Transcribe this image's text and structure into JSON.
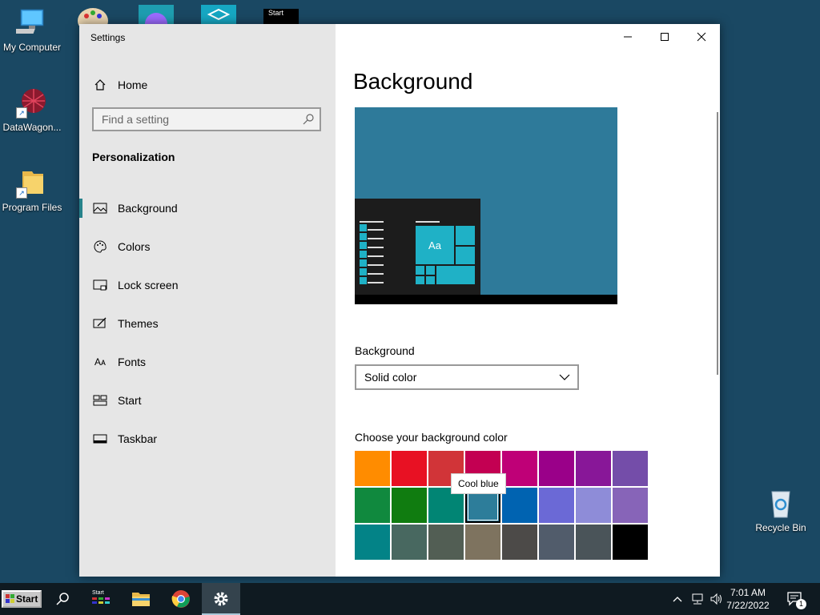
{
  "desktop": {
    "icons": [
      {
        "label": "My Computer"
      },
      {
        "label": "DataWagon..."
      },
      {
        "label": "Program Files"
      },
      {
        "label": "Recycle Bin"
      }
    ],
    "top_start_label": "Start"
  },
  "window": {
    "title": "Settings",
    "sidebar": {
      "home_label": "Home",
      "search_placeholder": "Find a setting",
      "section_title": "Personalization",
      "items": [
        {
          "label": "Background",
          "icon": "picture-icon"
        },
        {
          "label": "Colors",
          "icon": "palette-icon"
        },
        {
          "label": "Lock screen",
          "icon": "lock-screen-icon"
        },
        {
          "label": "Themes",
          "icon": "themes-icon"
        },
        {
          "label": "Fonts",
          "icon": "fonts-icon"
        },
        {
          "label": "Start",
          "icon": "start-icon"
        },
        {
          "label": "Taskbar",
          "icon": "taskbar-icon"
        }
      ],
      "active_item": "Background"
    },
    "main": {
      "title": "Background",
      "preview_tile_text": "Aa",
      "background_label": "Background",
      "background_value": "Solid color",
      "color_label": "Choose your background color",
      "tooltip": "Cool blue",
      "selected_color": "#2d7d9a",
      "swatches": [
        "#ff8c00",
        "#e81123",
        "#d13438",
        "#c30052",
        "#bf0077",
        "#9a0089",
        "#881798",
        "#744da9",
        "#10893e",
        "#107c10",
        "#018574",
        "#2d7d9a",
        "#0063b1",
        "#6b69d6",
        "#8e8cd8",
        "#8764b8",
        "#038387",
        "#486860",
        "#525e54",
        "#7e735f",
        "#4c4a48",
        "#515c6b",
        "#4a5459",
        "#000000"
      ]
    }
  },
  "taskbar": {
    "start_label": "Start",
    "time": "7:01 AM",
    "date": "7/22/2022",
    "notification_count": "1",
    "mini_start_label": "Start"
  },
  "colors": {
    "desktop_bg": "#1a4863",
    "accent": "#26828a",
    "preview_bg": "#2e7a9a",
    "tile": "#1fb1c6"
  }
}
